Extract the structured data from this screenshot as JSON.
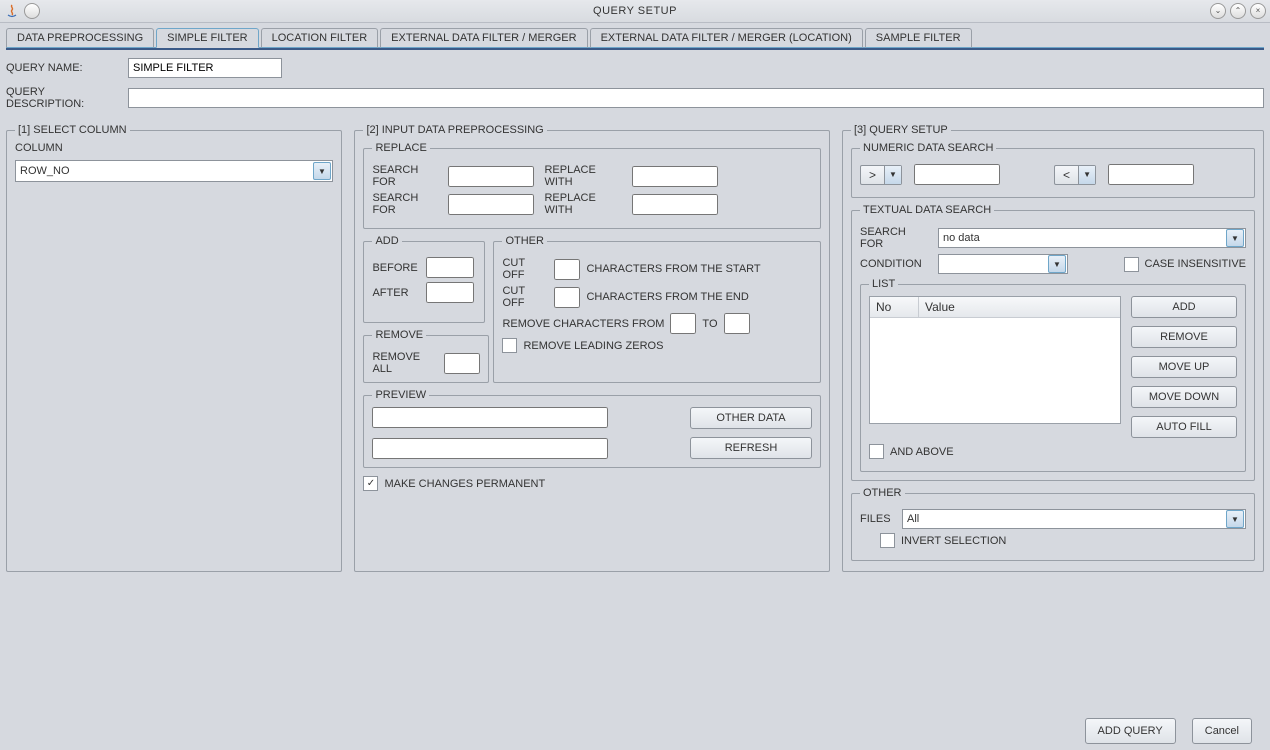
{
  "window": {
    "title": "QUERY SETUP"
  },
  "tabs": [
    {
      "label": "DATA PREPROCESSING"
    },
    {
      "label": "SIMPLE FILTER"
    },
    {
      "label": "LOCATION FILTER"
    },
    {
      "label": "EXTERNAL DATA FILTER / MERGER"
    },
    {
      "label": "EXTERNAL DATA FILTER / MERGER (LOCATION)"
    },
    {
      "label": "SAMPLE FILTER"
    }
  ],
  "header": {
    "query_name_label": "QUERY NAME:",
    "query_name_value": "SIMPLE FILTER",
    "query_desc_label": "QUERY DESCRIPTION:",
    "query_desc_value": ""
  },
  "panel1": {
    "legend": "[1] SELECT COLUMN",
    "column_label": "COLUMN",
    "column_value": "ROW_NO"
  },
  "panel2": {
    "legend": "[2] INPUT DATA PREPROCESSING",
    "replace": {
      "legend": "REPLACE",
      "search_for_label": "SEARCH FOR",
      "replace_with_label": "REPLACE WITH",
      "v1a": "",
      "v1b": "",
      "v2a": "",
      "v2b": ""
    },
    "add": {
      "legend": "ADD",
      "before_label": "BEFORE",
      "before_value": "",
      "after_label": "AFTER",
      "after_value": ""
    },
    "remove": {
      "legend": "REMOVE",
      "remove_all_label": "REMOVE ALL",
      "remove_all_value": ""
    },
    "other": {
      "legend": "OTHER",
      "cutoff_label": "CUT OFF",
      "from_start": "CHARACTERS FROM THE START",
      "from_end": "CHARACTERS FROM THE END",
      "remove_from": "REMOVE CHARACTERS FROM",
      "to_label": "TO",
      "leading_zeros_label": "REMOVE LEADING ZEROS",
      "cut1": "",
      "cut2": "",
      "rm_from": "",
      "rm_to": ""
    },
    "preview": {
      "legend": "PREVIEW",
      "v1": "",
      "v2": "",
      "other_data_btn": "OTHER DATA",
      "refresh_btn": "REFRESH"
    },
    "make_permanent_label": "MAKE CHANGES PERMANENT"
  },
  "panel3": {
    "legend": "[3] QUERY SETUP",
    "numeric": {
      "legend": "NUMERIC DATA SEARCH",
      "op1": ">",
      "v1": "",
      "op2": "<",
      "v2": ""
    },
    "textual": {
      "legend": "TEXTUAL DATA SEARCH",
      "search_for_label": "SEARCH FOR",
      "search_for_value": "no data",
      "condition_label": "CONDITION",
      "condition_value": "",
      "case_insensitive_label": "CASE INSENSITIVE",
      "list_legend": "LIST",
      "col_no": "No",
      "col_value": "Value",
      "add_btn": "ADD",
      "remove_btn": "REMOVE",
      "moveup_btn": "MOVE UP",
      "movedown_btn": "MOVE DOWN",
      "autofill_btn": "AUTO FILL",
      "and_above_label": "AND ABOVE"
    },
    "other": {
      "legend": "OTHER",
      "files_label": "FILES",
      "files_value": "All",
      "invert_label": "INVERT SELECTION"
    }
  },
  "footer": {
    "add_query": "ADD QUERY",
    "cancel": "Cancel"
  }
}
